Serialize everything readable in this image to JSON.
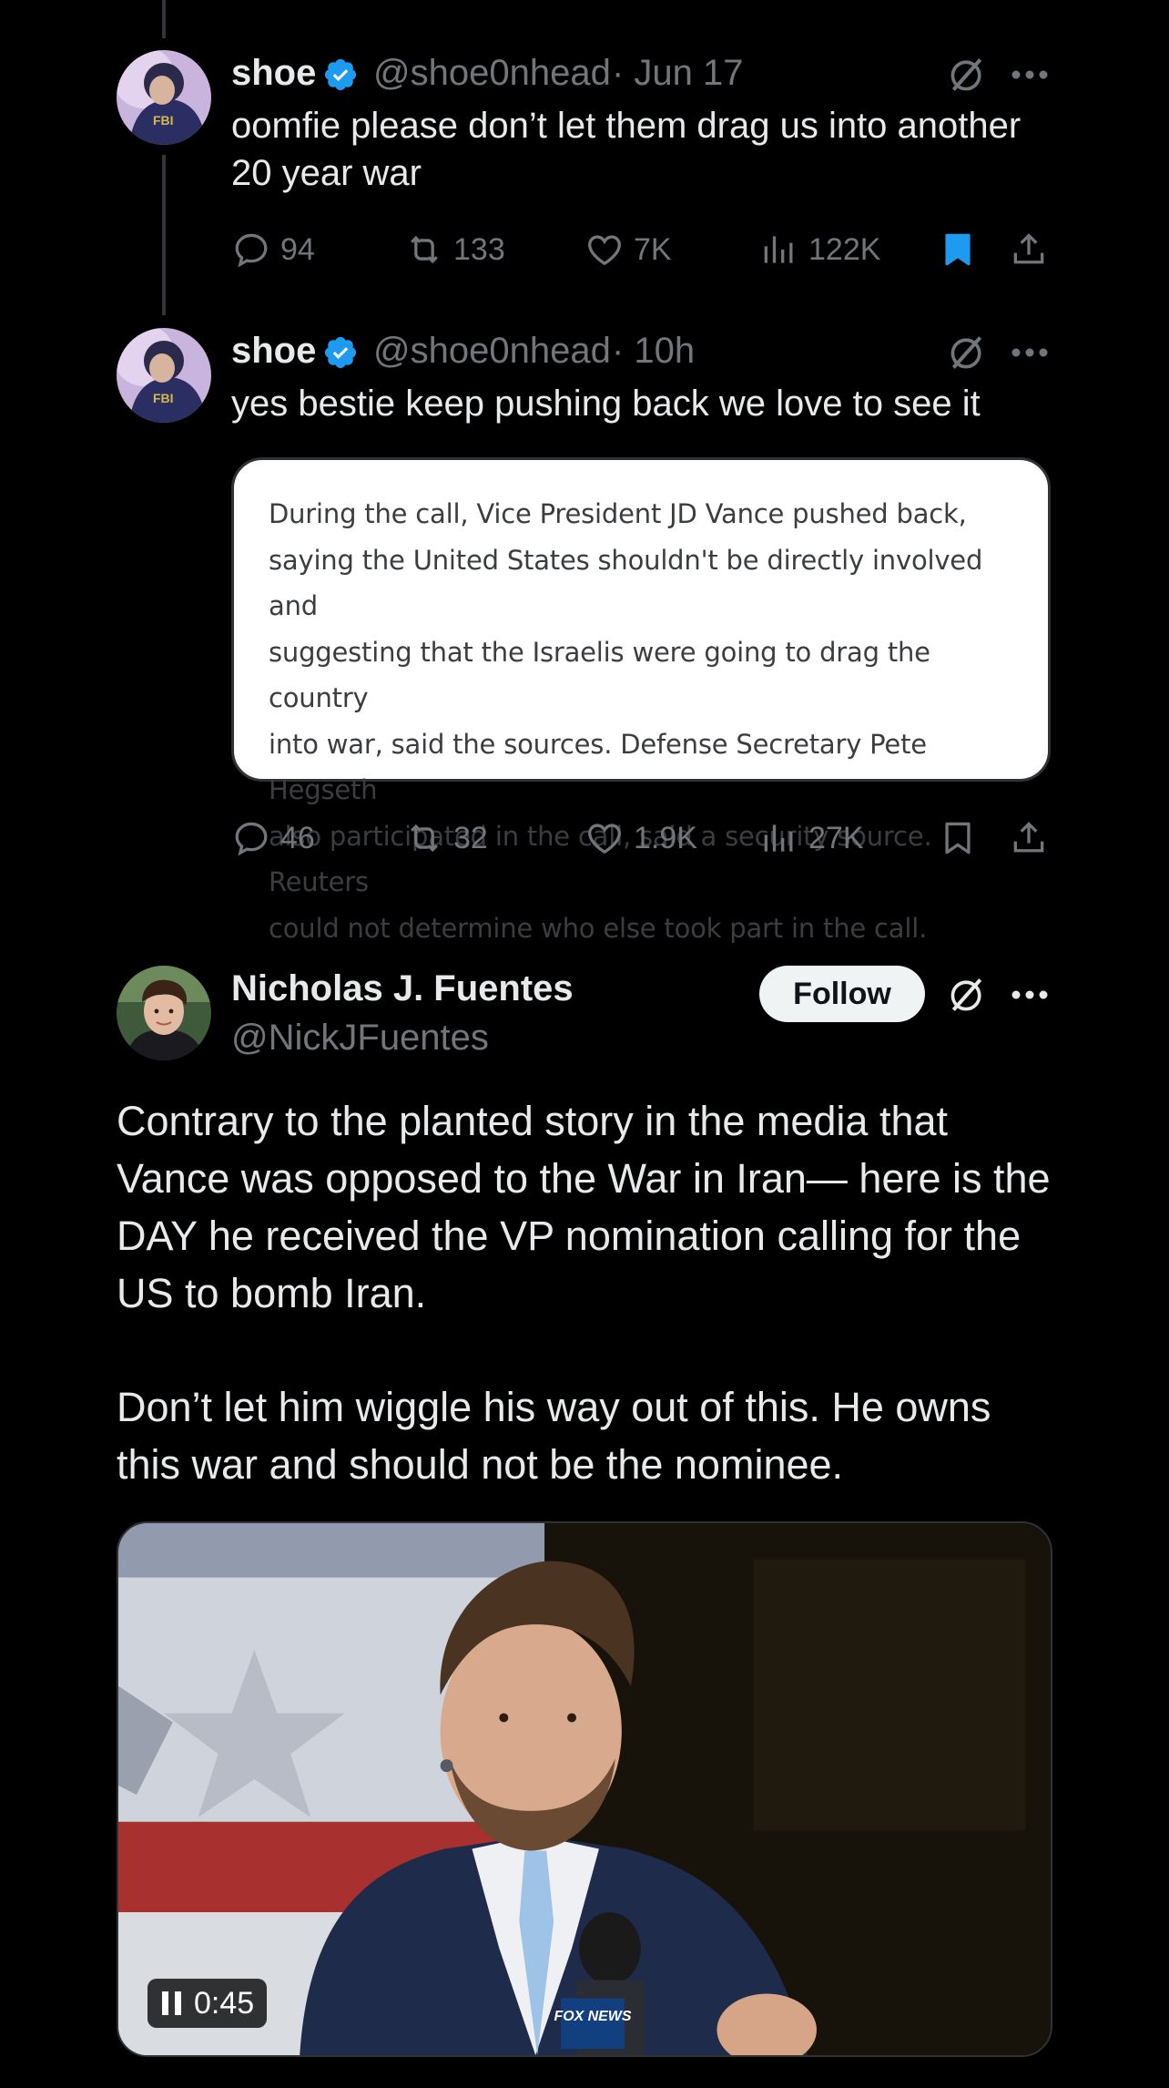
{
  "tweets": [
    {
      "author_name": "shoe",
      "handle": "@shoe0nhead",
      "time": "· Jun 17",
      "text_lines": [
        "oomfie please don’t let them drag us into another",
        "20 year war"
      ],
      "replies": "94",
      "reposts": "133",
      "likes": "7K",
      "views": "122K",
      "bookmarked": true
    },
    {
      "author_name": "shoe",
      "handle": "@shoe0nhead",
      "time": "· 10h",
      "text": "yes bestie keep pushing back we love to see it",
      "quote_lines": [
        "During the call, Vice President JD Vance pushed back,",
        "saying the United States shouldn't be directly involved and",
        "suggesting that the Israelis were going to drag the country",
        "into war, said the sources. Defense Secretary Pete Hegseth",
        "also participated in the call, said a security source. Reuters",
        "could not determine who else took part in the call."
      ],
      "replies": "46",
      "reposts": "32",
      "likes": "1.9K",
      "views": "27K",
      "bookmarked": false
    }
  ],
  "main_tweet": {
    "author_name": "Nicholas J. Fuentes",
    "handle": "@NickJFuentes",
    "follow_label": "Follow",
    "paragraph1_lines": [
      "Contrary to the planted story in the media that",
      "Vance was opposed to the War in Iran— here is the",
      "DAY he received the VP nomination calling for the",
      "US to bomb Iran."
    ],
    "paragraph2_lines": [
      "Don’t let him wiggle his way out of this. He owns",
      "this war and should not be the nominee."
    ],
    "video_time": "0:45",
    "video_logo_text": "FOX NEWS"
  },
  "icons": {
    "reply": "reply-icon",
    "repost": "repost-icon",
    "like": "heart-icon",
    "views": "views-icon",
    "bookmark": "bookmark-icon",
    "share": "share-icon",
    "grok": "grok-icon",
    "more": "more-icon",
    "verified": "verified-badge-icon",
    "pause": "pause-icon"
  },
  "colors": {
    "background": "#000000",
    "text_primary": "#e7e9ea",
    "text_secondary": "#71767b",
    "verified_blue": "#1d9bf0",
    "bookmark_active": "#1d9bf0",
    "follow_button_bg": "#eff3f4"
  }
}
